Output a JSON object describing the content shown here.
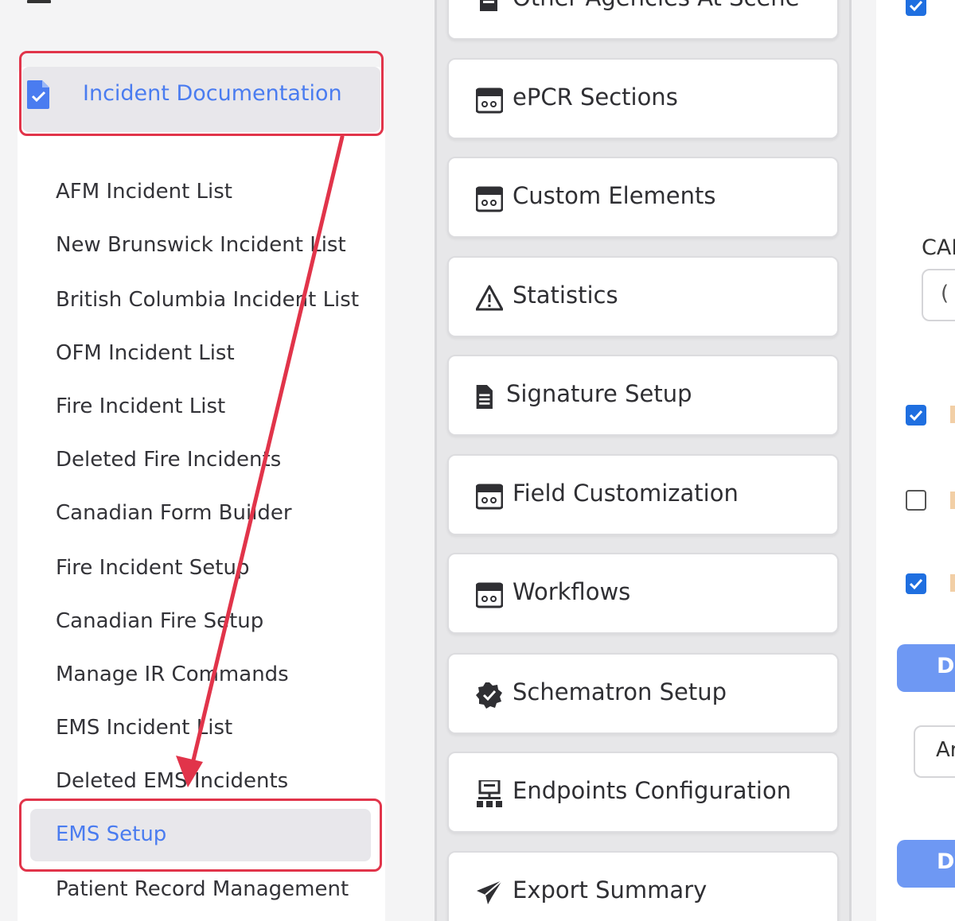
{
  "sidebar": {
    "header_title": "Incident Documentation",
    "items": [
      {
        "label": "AFM Incident List"
      },
      {
        "label": "New Brunswick Incident List"
      },
      {
        "label": "British Columbia Incident List"
      },
      {
        "label": "OFM Incident List"
      },
      {
        "label": "Fire Incident List"
      },
      {
        "label": "Deleted Fire Incidents"
      },
      {
        "label": "Canadian Form Builder"
      },
      {
        "label": "Fire Incident Setup"
      },
      {
        "label": "Canadian Fire Setup"
      },
      {
        "label": "Manage IR Commands"
      },
      {
        "label": "EMS Incident List"
      },
      {
        "label": "Deleted EMS Incidents"
      },
      {
        "label": "EMS Setup",
        "active": true
      },
      {
        "label": "Patient Record Management"
      }
    ]
  },
  "cards": [
    {
      "label": "Other Agencies At Scene",
      "icon": "document-icon"
    },
    {
      "label": "ePCR Sections",
      "icon": "calendar-icon"
    },
    {
      "label": "Custom Elements",
      "icon": "calendar-icon"
    },
    {
      "label": "Statistics",
      "icon": "warning-icon"
    },
    {
      "label": "Signature Setup",
      "icon": "document-icon"
    },
    {
      "label": "Field Customization",
      "icon": "calendar-icon"
    },
    {
      "label": "Workflows",
      "icon": "calendar-icon"
    },
    {
      "label": "Schematron Setup",
      "icon": "badge-check-icon"
    },
    {
      "label": "Endpoints Configuration",
      "icon": "network-icon"
    },
    {
      "label": "Export Summary",
      "icon": "paper-plane-icon"
    }
  ],
  "right_panel": {
    "cad_label": "CAI",
    "cad_input_value": "(",
    "button_1_label": "D",
    "input_value": "Ar",
    "button_2_label": "D",
    "checkboxes": [
      true,
      true,
      false,
      true
    ]
  },
  "colors": {
    "accent": "#4a7cf0",
    "highlight": "#e1344a",
    "checkbox": "#1f6fe0",
    "button": "#6e98f3"
  }
}
